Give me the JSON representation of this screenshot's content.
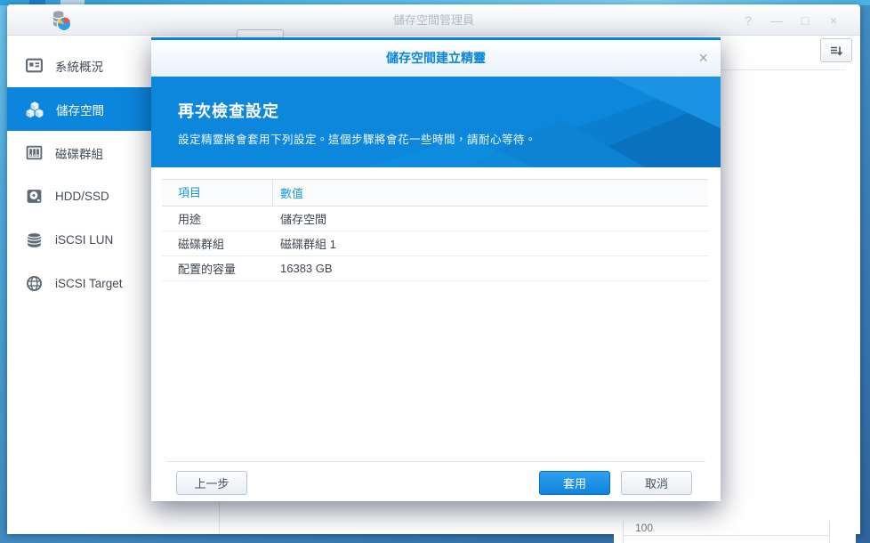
{
  "window": {
    "title": "儲存空間管理員",
    "controls": {
      "help": "?",
      "minimize": "—",
      "maximize": "□",
      "close": "×"
    }
  },
  "sidebar": {
    "items": [
      {
        "label": "系統概況",
        "selected": false
      },
      {
        "label": "儲存空間",
        "selected": true
      },
      {
        "label": "磁碟群組",
        "selected": false
      },
      {
        "label": "HDD/SSD",
        "selected": false
      },
      {
        "label": "iSCSI LUN",
        "selected": false
      },
      {
        "label": "iSCSI Target",
        "selected": false
      }
    ]
  },
  "background": {
    "partial_value": "100"
  },
  "dialog": {
    "title": "儲存空間建立精靈",
    "close": "×",
    "header": {
      "title": "再次檢查設定",
      "subtitle": "設定精靈將會套用下列設定。這個步驟將會花一些時間，請耐心等待。"
    },
    "table": {
      "columns": [
        "項目",
        "數值"
      ],
      "rows": [
        {
          "item": "用途",
          "value": "儲存空間"
        },
        {
          "item": "磁碟群組",
          "value": "磁碟群組 1"
        },
        {
          "item": "配置的容量",
          "value": "16383 GB"
        }
      ]
    },
    "buttons": {
      "back": "上一步",
      "apply": "套用",
      "cancel": "取消"
    }
  },
  "colors": {
    "accent": "#0c86dd",
    "dialog_header": "#0d87dc",
    "apply_button": "#1590e6",
    "dialog_title_text": "#0a86d9"
  }
}
